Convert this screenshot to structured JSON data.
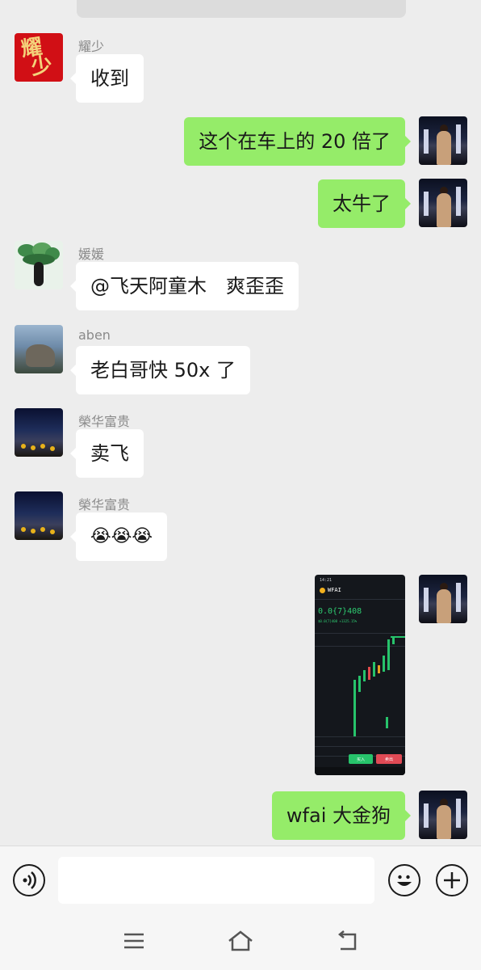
{
  "messages": [
    {
      "sender": "耀少",
      "text": "收到"
    },
    {
      "text": "这个在车上的 20 倍了"
    },
    {
      "text": "太牛了"
    },
    {
      "sender": "媛媛",
      "text": "@飞天阿童木　爽歪歪"
    },
    {
      "sender": "aben",
      "text": "老白哥快 50x 了"
    },
    {
      "sender": "榮华富贵",
      "text": "卖飞"
    },
    {
      "sender": "榮华富贵",
      "text": "😭😭😭"
    },
    {
      "text": "wfai 大金狗"
    }
  ],
  "avatars": {
    "yao_text": "耀少"
  },
  "screenshot": {
    "time": "14:21",
    "token": "WFAI",
    "price": "0.0{7}408",
    "sub_price": "$0.0{7}408 +1325.15%",
    "buy_label": "买入",
    "sell_label": "卖出"
  },
  "colors": {
    "green_bubble": "#95ec69",
    "white_bubble": "#ffffff",
    "background": "#ededed"
  },
  "icons": {
    "voice": "voice-icon",
    "emoji": "emoji-icon",
    "plus": "plus-icon",
    "menu": "menu-icon",
    "home": "home-icon",
    "back": "back-icon"
  }
}
